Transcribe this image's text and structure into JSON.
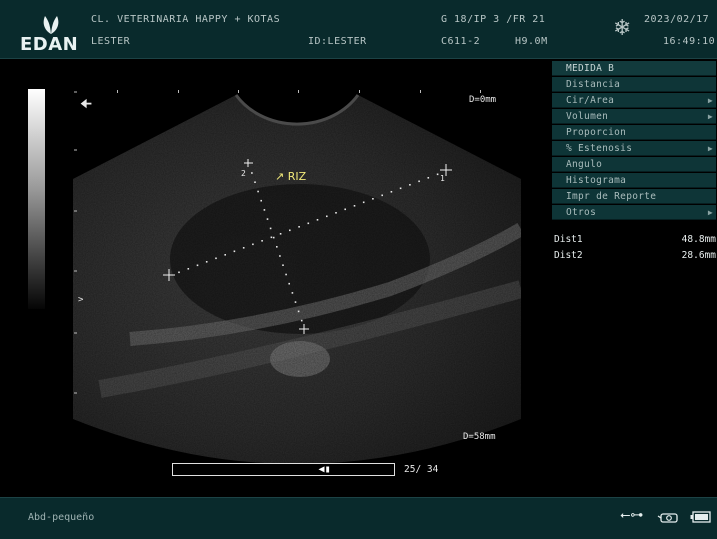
{
  "header": {
    "logo_text": "EDAN",
    "clinic": "CL. VETERINARIA HAPPY + KOTAS",
    "patient": "LESTER",
    "patient_id": "ID:LESTER",
    "gain_line": "G 18/IP 3 /FR 21",
    "probe": "C611-2",
    "frequency": "H9.0M",
    "date": "2023/02/17",
    "time": "16:49:10",
    "freeze_icon": "snowflake-icon"
  },
  "image": {
    "depth_top": "D=0mm",
    "depth_bottom": "D=58mm",
    "annotation": "↗ RIZ",
    "caliper_1_label": "1",
    "caliper_2_label": "2",
    "focus_marker": ">",
    "orientation_marker": "🠈",
    "cine_frame": "25/ 34",
    "cine_fraction": 0.71
  },
  "menu": {
    "title": "MEDIDA B",
    "items": [
      {
        "label": "Distancia",
        "submenu": false
      },
      {
        "label": "Cir/Area",
        "submenu": true
      },
      {
        "label": "Volumen",
        "submenu": true
      },
      {
        "label": "Proporcion",
        "submenu": false
      },
      {
        "label": "% Estenosis",
        "submenu": true
      },
      {
        "label": "Angulo",
        "submenu": false
      },
      {
        "label": "Histograma",
        "submenu": false
      },
      {
        "label": "Impr de Reporte",
        "submenu": false
      },
      {
        "label": "Otros",
        "submenu": true
      }
    ]
  },
  "results": [
    {
      "label": "Dist1",
      "value": "48.8mm"
    },
    {
      "label": "Dist2",
      "value": "28.6mm"
    }
  ],
  "footer": {
    "preset": "Abd-pequeño",
    "icons": [
      "usb-icon",
      "printer-icon",
      "battery-icon"
    ]
  }
}
